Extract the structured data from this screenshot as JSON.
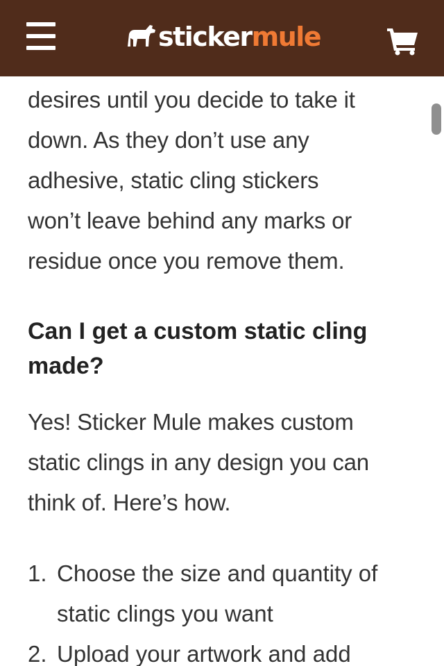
{
  "header": {
    "menu_icon": "hamburger-menu-icon",
    "logo_icon": "mule-icon",
    "logo_part_1": "sticker",
    "logo_part_2": "mule",
    "cart_icon": "shopping-cart-icon",
    "background_color": "#502c1b",
    "accent_color": "#f07a34"
  },
  "article": {
    "intro_lines": [
      "desires until you decide to take it",
      "down. As they don’t use any",
      "adhesive, static cling stickers",
      "won’t leave behind any marks or",
      "residue once you remove them."
    ],
    "heading_lines": [
      "Can I get a custom static cling",
      "made?"
    ],
    "answer_lines": [
      "Yes! Sticker Mule makes custom",
      "static clings in any design you can",
      "think of. Here’s how."
    ],
    "steps": [
      {
        "number": "1.",
        "lines": [
          "Choose the size and quantity of",
          "static clings you want"
        ]
      },
      {
        "number": "2.",
        "lines": [
          "Upload your artwork and add"
        ]
      }
    ]
  }
}
